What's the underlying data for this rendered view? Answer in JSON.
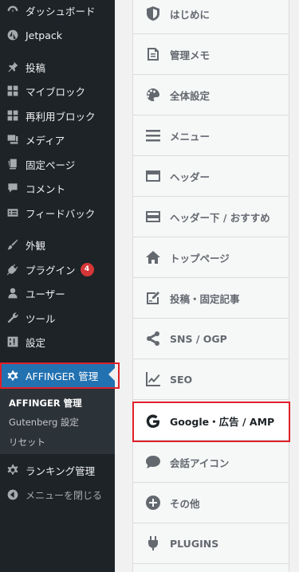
{
  "sidebar": {
    "items": [
      {
        "label": "ダッシュボード",
        "icon": "dashboard-icon"
      },
      {
        "label": "Jetpack",
        "icon": "jetpack-icon"
      },
      {
        "label": "投稿",
        "icon": "pin-icon"
      },
      {
        "label": "マイブロック",
        "icon": "blocks-icon"
      },
      {
        "label": "再利用ブロック",
        "icon": "blocks-icon"
      },
      {
        "label": "メディア",
        "icon": "media-icon"
      },
      {
        "label": "固定ページ",
        "icon": "page-icon"
      },
      {
        "label": "コメント",
        "icon": "comment-icon"
      },
      {
        "label": "フィードバック",
        "icon": "feedback-icon"
      },
      {
        "label": "外観",
        "icon": "brush-icon"
      },
      {
        "label": "プラグイン",
        "icon": "plugin-icon",
        "badge": "4"
      },
      {
        "label": "ユーザー",
        "icon": "user-icon"
      },
      {
        "label": "ツール",
        "icon": "wrench-icon"
      },
      {
        "label": "設定",
        "icon": "settings-icon"
      },
      {
        "label": "AFFINGER 管理",
        "icon": "gear-icon",
        "active": true
      }
    ],
    "submenu": [
      "AFFINGER 管理",
      "Gutenberg 設定",
      "リセット"
    ],
    "after": [
      {
        "label": "ランキング管理",
        "icon": "gear-icon"
      },
      {
        "label": "メニューを閉じる",
        "icon": "collapse-icon"
      }
    ],
    "accent": "#2271b1",
    "badge_color": "#d63638"
  },
  "panel": {
    "items": [
      {
        "label": "はじめに",
        "icon": "shield-icon"
      },
      {
        "label": "管理メモ",
        "icon": "document-icon"
      },
      {
        "label": "全体設定",
        "icon": "palette-icon"
      },
      {
        "label": "メニュー",
        "icon": "menu-icon"
      },
      {
        "label": "ヘッダー",
        "icon": "header-icon"
      },
      {
        "label": "ヘッダー下 / おすすめ",
        "icon": "header-below-icon"
      },
      {
        "label": "トップページ",
        "icon": "home-icon"
      },
      {
        "label": "投稿・固定記事",
        "icon": "edit-icon"
      },
      {
        "label": "SNS / OGP",
        "icon": "share-icon"
      },
      {
        "label": "SEO",
        "icon": "chart-line-icon"
      },
      {
        "label": "Google・広告 / AMP",
        "icon": "google-icon",
        "selected": true
      },
      {
        "label": "会話アイコン",
        "icon": "speech-bubble-icon"
      },
      {
        "label": "その他",
        "icon": "plus-circle-icon"
      },
      {
        "label": "PLUGINS",
        "icon": "plug-icon"
      }
    ],
    "highlight_color": "#e0202a"
  }
}
